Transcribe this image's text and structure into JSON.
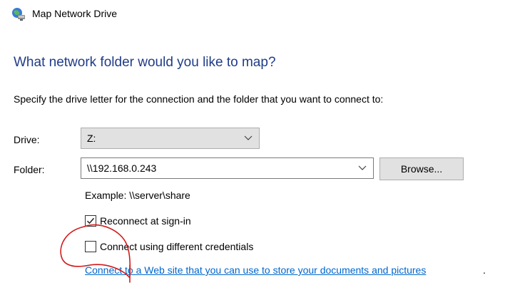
{
  "window": {
    "title": "Map Network Drive",
    "icon": "network-drive-icon"
  },
  "main": {
    "heading": "What network folder would you like to map?",
    "instruction": "Specify the drive letter for the connection and the folder that you want to connect to:",
    "drive": {
      "label": "Drive:",
      "value": "Z:"
    },
    "folder": {
      "label": "Folder:",
      "value": "\\\\192.168.0.243",
      "browse_label": "Browse..."
    },
    "example": "Example: \\\\server\\share",
    "reconnect": {
      "label": "Reconnect at sign-in",
      "checked": true
    },
    "credentials": {
      "label": "Connect using different credentials",
      "checked": false
    },
    "web_link": "Connect to a Web site that you can use to store your documents and pictures",
    "link_suffix": "."
  },
  "colors": {
    "heading": "#1f3c88",
    "link": "#0066cc",
    "annotation": "#d11a1a"
  }
}
